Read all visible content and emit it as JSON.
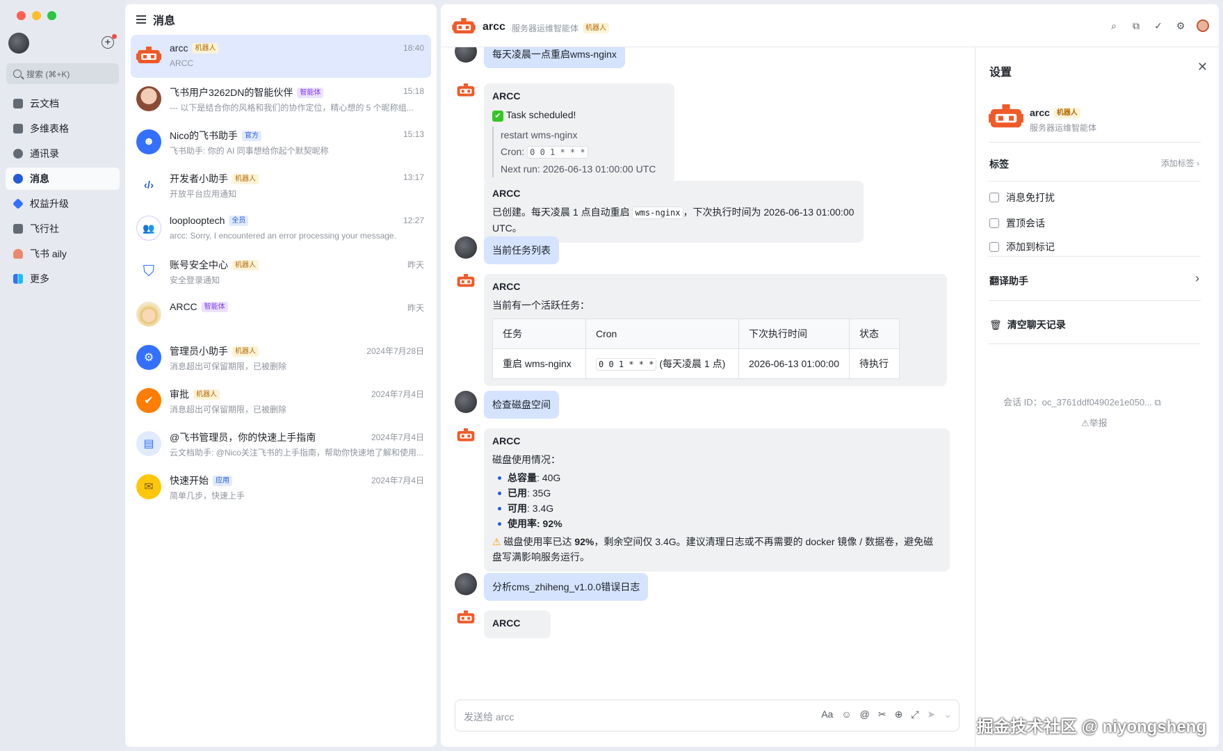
{
  "colors": {
    "accent": "#245bdb",
    "bot_orange": "#f05a28",
    "selected_row": "#e0e9ff",
    "user_bubble": "#d5e3ff"
  },
  "sidebar": {
    "search_placeholder": "搜索 (⌘+K)",
    "items": [
      {
        "label": "云文档",
        "icon": "docs-icon",
        "color": "#646a73"
      },
      {
        "label": "多维表格",
        "icon": "base-icon",
        "color": "#646a73"
      },
      {
        "label": "通讯录",
        "icon": "contacts-icon",
        "color": "#646a73"
      },
      {
        "label": "消息",
        "icon": "messages-icon",
        "color": "#245bdb"
      },
      {
        "label": "权益升级",
        "icon": "diamond-icon",
        "color": "#3370ff"
      },
      {
        "label": "飞行社",
        "icon": "book-icon",
        "color": "#646a73"
      },
      {
        "label": "飞书 aily",
        "icon": "aily-icon",
        "color": "#e88a6d"
      },
      {
        "label": "更多",
        "icon": "more-apps-icon",
        "color": "#3370ff"
      }
    ]
  },
  "chatlist": {
    "title": "消息",
    "rows": [
      {
        "name": "arcc",
        "tag": "机器人",
        "tag_kind": "bot",
        "time": "18:40",
        "preview": "ARCC",
        "avatar": "robot",
        "avatar_color": "#f05a28"
      },
      {
        "name": "飞书用户3262DN的智能伙伴",
        "tag": "智能体",
        "tag_kind": "ai",
        "time": "15:18",
        "preview": "--- 以下是结合你的风格和我们的协作定位，精心想的 5 个昵称组...",
        "avatar": "person",
        "avatar_color": "#e9b49a"
      },
      {
        "name": "Nico的飞书助手",
        "tag": "官方",
        "tag_kind": "blue",
        "time": "15:13",
        "preview": "飞书助手: 你的 AI 同事想给你起个默契昵称",
        "avatar": "bot-face",
        "avatar_color": "#3370ff"
      },
      {
        "name": "开发者小助手",
        "tag": "机器人",
        "tag_kind": "bot",
        "time": "13:17",
        "preview": "开放平台应用通知",
        "avatar": "code",
        "avatar_color": "#ffffff"
      },
      {
        "name": "looplooptech",
        "tag": "全员",
        "tag_kind": "blue",
        "time": "12:27",
        "preview": "arcc: Sorry, I encountered an error processing your message.",
        "avatar": "group",
        "avatar_color": "#ffffff"
      },
      {
        "name": "账号安全中心",
        "tag": "机器人",
        "tag_kind": "bot",
        "time": "昨天",
        "preview": "安全登录通知",
        "avatar": "shield",
        "avatar_color": "#ffffff"
      },
      {
        "name": "ARCC",
        "tag": "智能体",
        "tag_kind": "ai",
        "time": "昨天",
        "preview": "",
        "avatar": "cartoon",
        "avatar_color": "#f4e4c1"
      },
      {
        "name": "管理员小助手",
        "tag": "机器人",
        "tag_kind": "bot",
        "time": "2024年7月28日",
        "preview": "消息超出可保留期限，已被删除",
        "avatar": "admin",
        "avatar_color": "#3370ff"
      },
      {
        "name": "审批",
        "tag": "机器人",
        "tag_kind": "bot",
        "time": "2024年7月4日",
        "preview": "消息超出可保留期限，已被删除",
        "avatar": "approve",
        "avatar_color": "#ff7d00"
      },
      {
        "name": "@飞书管理员，你的快速上手指南",
        "tag": "",
        "tag_kind": "",
        "time": "2024年7月4日",
        "preview": "云文档助手: @Nico关注飞书的上手指南，帮助你快速地了解和使用...",
        "avatar": "doc",
        "avatar_color": "#e1eaff"
      },
      {
        "name": "快速开始",
        "tag": "应用",
        "tag_kind": "blue",
        "time": "2024年7月4日",
        "preview": "简单几步，快速上手",
        "avatar": "quick",
        "avatar_color": "#ffc60a"
      }
    ]
  },
  "chat": {
    "title": "arcc",
    "subtitle": "服务器运维智能体",
    "tag": "机器人",
    "msg_user_1": "每天凌晨一点重启wms-nginx",
    "bot_name": "ARCC",
    "task_scheduled": "Task scheduled!",
    "task_detail_1": "restart wms-nginx",
    "task_cron_label": "Cron:",
    "task_cron": "0 0 1 * * *",
    "task_next": "Next run: 2026-06-13 01:00:00 UTC",
    "created_pre": "已创建。每天凌晨 1 点自动重启",
    "created_code": "wms-nginx",
    "created_post": "，下次执行时间为 2026-06-13 01:00:00 UTC。",
    "msg_user_2": "当前任务列表",
    "active_tasks": "当前有一个活跃任务：",
    "table_headers": [
      "任务",
      "Cron",
      "下次执行时间",
      "状态"
    ],
    "table_row": {
      "task": "重启 wms-nginx",
      "cron": "0 0 1 * * *",
      "cron_note": "(每天凌晨 1 点)",
      "next": "2026-06-13 01:00:00",
      "status": "待执行"
    },
    "msg_user_3": "检查磁盘空间",
    "disk_title": "磁盘使用情况：",
    "disk": [
      {
        "label": "总容量",
        "value": ": 40G"
      },
      {
        "label": "已用",
        "value": ": 35G"
      },
      {
        "label": "可用",
        "value": ": 3.4G"
      },
      {
        "label": "使用率",
        "value": ": 92%"
      }
    ],
    "warn_pre": "磁盘使用率已达",
    "warn_pct": "92%",
    "warn_post": "，剩余空间仅 3.4G。建议清理日志或不再需要的 docker 镜像 / 数据卷，避免磁盘写满影响服务运行。",
    "msg_user_4": "分析cms_zhiheng_v1.0.0错误日志",
    "composer_placeholder": "发送给 arcc"
  },
  "settings": {
    "title": "设置",
    "name": "arcc",
    "tag": "机器人",
    "desc": "服务器运维智能体",
    "labels_title": "标签",
    "add_label": "添加标签",
    "opt_mute": "消息免打扰",
    "opt_pin": "置顶会话",
    "opt_mark": "添加到标记",
    "translate": "翻译助手",
    "clear": "清空聊天记录",
    "session_id": "会话 ID：oc_3761ddf04902e1e050...",
    "report": "⚠举报"
  },
  "watermark": "掘金技术社区 @ niyongsheng"
}
